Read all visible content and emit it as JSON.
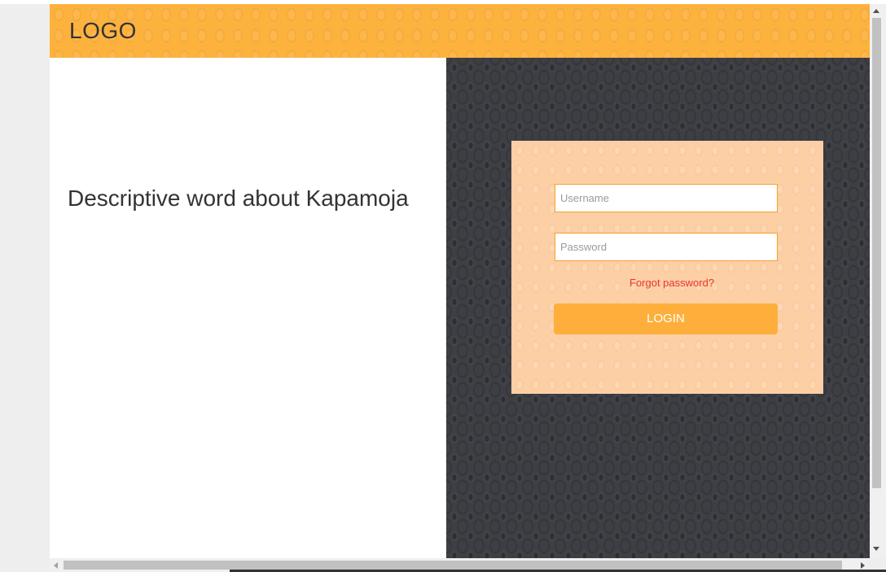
{
  "header": {
    "logo_text": "LOGO",
    "background_color": "#feb23e"
  },
  "left_panel": {
    "tagline": "Descriptive word about Kapamoja"
  },
  "login_form": {
    "username_placeholder": "Username",
    "username_value": "",
    "password_placeholder": "Password",
    "password_value": "",
    "forgot_password_label": "Forgot password?",
    "login_button_label": "LOGIN",
    "card_color": "#fdcfa5",
    "accent_color": "#feaf3b",
    "link_color": "#e8362a"
  },
  "scrollbars": {
    "vertical": {
      "up_icon": "arrow-up-icon",
      "down_icon": "arrow-down-icon"
    },
    "horizontal": {
      "left_icon": "arrow-left-icon",
      "right_icon": "arrow-right-icon"
    }
  }
}
